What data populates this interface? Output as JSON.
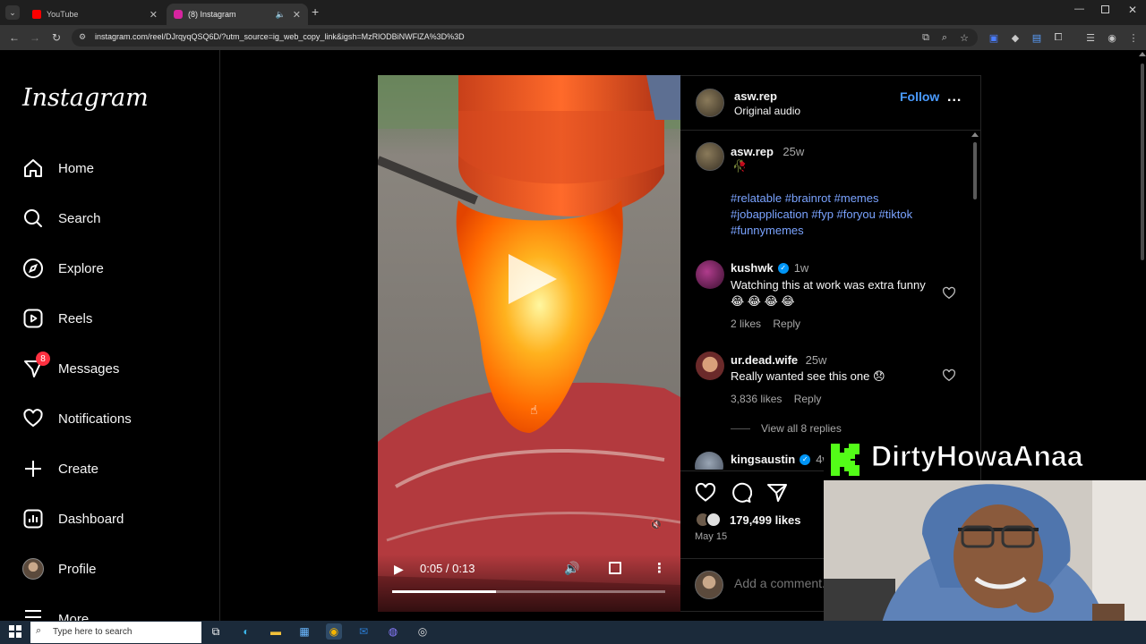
{
  "browser": {
    "tabs": [
      {
        "label": "YouTube",
        "active": false,
        "color": "#ff0000"
      },
      {
        "label": "(8) Instagram",
        "active": true,
        "color": "#d6249f"
      }
    ],
    "url": "instagram.com/reel/DJrqyqQSQ6D/?utm_source=ig_web_copy_link&igsh=MzRlODBiNWFlZA%3D%3D",
    "new_tab_label": "+"
  },
  "sidebar": {
    "logo": "Instagram",
    "items": [
      {
        "label": "Home",
        "icon": "home-icon"
      },
      {
        "label": "Search",
        "icon": "search-icon"
      },
      {
        "label": "Explore",
        "icon": "compass-icon"
      },
      {
        "label": "Reels",
        "icon": "reels-icon"
      },
      {
        "label": "Messages",
        "icon": "messenger-icon",
        "badge": "8"
      },
      {
        "label": "Notifications",
        "icon": "heart-icon"
      },
      {
        "label": "Create",
        "icon": "plus-icon"
      },
      {
        "label": "Dashboard",
        "icon": "dashboard-icon"
      },
      {
        "label": "Profile",
        "icon": "profile-avatar"
      },
      {
        "label": "More",
        "icon": "menu-icon"
      }
    ]
  },
  "video": {
    "time": "0:05 / 0:13",
    "progress": 0.38
  },
  "post": {
    "header": {
      "username": "asw.rep",
      "subtitle": "Original audio",
      "follow": "Follow",
      "more": "..."
    },
    "caption": {
      "username": "asw.rep",
      "age": "25w",
      "hashtags_line1": "#relatable #brainrot #memes",
      "hashtags_line2": "#jobapplication #fyp #foryou #tiktok",
      "hashtags_line3": "#funnymemes"
    },
    "comments": [
      {
        "username": "kushwk",
        "verified": true,
        "age": "1w",
        "text": "Watching this at work was extra funny😂 😂 😂 😂",
        "likes": "2 likes",
        "reply": "Reply"
      },
      {
        "username": "ur.dead.wife",
        "verified": false,
        "age": "25w",
        "text": "Really wanted see this one 😞",
        "likes": "3,836 likes",
        "reply": "Reply",
        "view_replies": "View all 8 replies"
      },
      {
        "username": "kingsaustin",
        "verified": true,
        "age": "4w"
      }
    ],
    "likes": "179,499 likes",
    "date": "May 15",
    "add_comment_placeholder": "Add a comment..."
  },
  "taskbar": {
    "search_placeholder": "Type here to search"
  },
  "overlay": {
    "channel_name": "DirtyHowaAnaa"
  },
  "colors": {
    "accent_link": "#7aa3ff",
    "follow_blue": "#0095f6",
    "badge_red": "#ff3040",
    "kick_green": "#53fc18"
  }
}
